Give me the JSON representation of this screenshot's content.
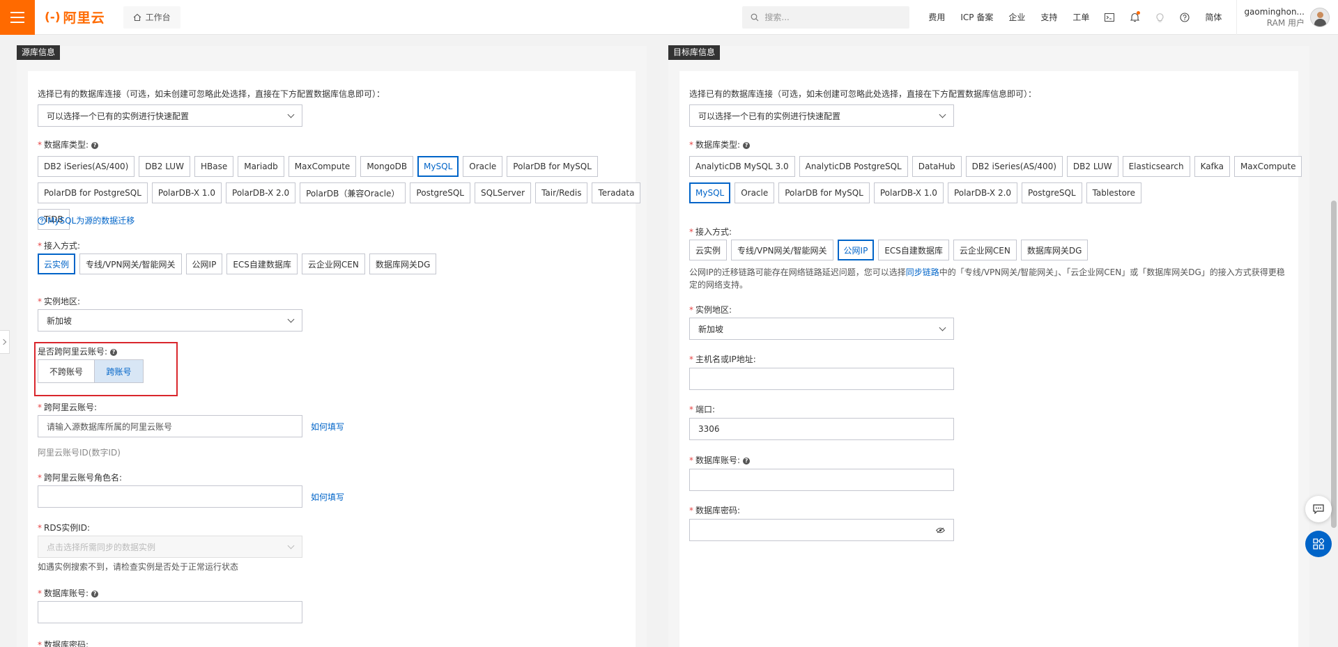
{
  "header": {
    "logo_text": "阿里云",
    "workbench": "工作台",
    "search_placeholder": "搜索...",
    "nav": [
      "费用",
      "ICP 备案",
      "企业",
      "支持",
      "工单"
    ],
    "lang": "简体",
    "user_name": "gaominghon...",
    "user_role": "RAM 用户",
    "accent": "#ff6a00"
  },
  "source": {
    "title": "源库信息",
    "existing_label": "选择已有的数据库连接（可选，如未创建可忽略此处选择，直接在下方配置数据库信息即可）：",
    "existing_placeholder": "可以选择一个已有的实例进行快速配置",
    "db_type_label": "数据库类型:",
    "db_types": [
      "DB2 iSeries(AS/400)",
      "DB2 LUW",
      "HBase",
      "Mariadb",
      "MaxCompute",
      "MongoDB",
      "MySQL",
      "Oracle",
      "PolarDB for MySQL",
      "PolarDB for PostgreSQL",
      "PolarDB-X 1.0",
      "PolarDB-X 2.0",
      "PolarDB（兼容Oracle）",
      "PostgreSQL",
      "SQLServer",
      "Tair/Redis",
      "Teradata",
      "TiDB"
    ],
    "db_type_selected": "MySQL",
    "migration_link": "MySQL为源的数据迁移",
    "access_label": "接入方式:",
    "access_methods": [
      "云实例",
      "专线/VPN网关/智能网关",
      "公网IP",
      "ECS自建数据库",
      "云企业网CEN",
      "数据库网关DG"
    ],
    "access_selected": "云实例",
    "region_label": "实例地区:",
    "region_value": "新加坡",
    "cross_label": "是否跨阿里云账号:",
    "cross_options": [
      "不跨账号",
      "跨账号"
    ],
    "cross_selected": "跨账号",
    "cross_account_label": "跨阿里云账号:",
    "cross_account_placeholder": "请输入源数据库所属的阿里云账号",
    "how_to_fill": "如何填写",
    "cross_account_hint": "阿里云账号ID(数字ID)",
    "role_label": "跨阿里云账号角色名:",
    "rds_label": "RDS实例ID:",
    "rds_placeholder": "点击选择所需同步的数据实例",
    "rds_hint": "如遇实例搜索不到，请检查实例是否处于正常运行状态",
    "account_label": "数据库账号:",
    "password_label": "数据库密码:"
  },
  "target": {
    "title": "目标库信息",
    "existing_label": "选择已有的数据库连接（可选，如未创建可忽略此处选择，直接在下方配置数据库信息即可）：",
    "existing_placeholder": "可以选择一个已有的实例进行快速配置",
    "db_type_label": "数据库类型:",
    "db_types": [
      "AnalyticDB MySQL 3.0",
      "AnalyticDB PostgreSQL",
      "DataHub",
      "DB2 iSeries(AS/400)",
      "DB2 LUW",
      "Elasticsearch",
      "Kafka",
      "MaxCompute",
      "MySQL",
      "Oracle",
      "PolarDB for MySQL",
      "PolarDB-X 1.0",
      "PolarDB-X 2.0",
      "PostgreSQL",
      "Tablestore"
    ],
    "db_type_selected": "MySQL",
    "access_label": "接入方式:",
    "access_methods": [
      "云实例",
      "专线/VPN网关/智能网关",
      "公网IP",
      "ECS自建数据库",
      "云企业网CEN",
      "数据库网关DG"
    ],
    "access_selected": "公网IP",
    "note_pre": "公网IP的迁移链路可能存在网络链路延迟问题，您可以选择",
    "note_link": "同步链路",
    "note_post": "中的「专线/VPN网关/智能网关」、「云企业网CEN」或「数据库网关DG」的接入方式获得更稳定的网络支持。",
    "region_label": "实例地区:",
    "region_value": "新加坡",
    "host_label": "主机名或IP地址:",
    "port_label": "端口:",
    "port_value": "3306",
    "account_label": "数据库账号:",
    "password_label": "数据库密码:"
  }
}
